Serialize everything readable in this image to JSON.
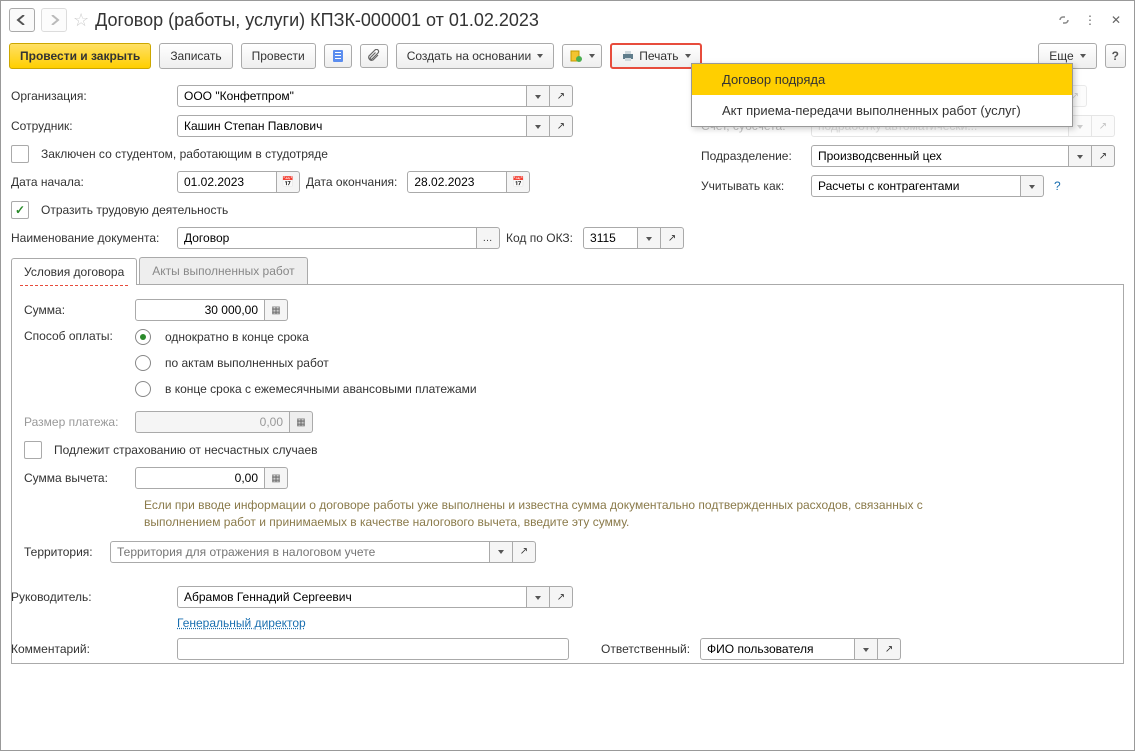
{
  "title": "Договор (работы, услуги) КПЗК-000001 от 01.02.2023",
  "toolbar": {
    "post_close": "Провести и закрыть",
    "save": "Записать",
    "post": "Провести",
    "create_based": "Создать на основании",
    "print": "Печать",
    "more": "Еще",
    "help": "?"
  },
  "print_menu": {
    "item1": "Договор подряда",
    "item2": "Акт приема-передачи выполненных работ (услуг)"
  },
  "left": {
    "org_label": "Организация:",
    "org_value": "ООО \"Конфетпром\"",
    "emp_label": "Сотрудник:",
    "emp_value": "Кашин Степан Павлович",
    "student_cb": "Заключен со студентом, работающим в студотряде",
    "date_start_label": "Дата начала:",
    "date_start": "01.02.2023",
    "date_end_label": "Дата окончания:",
    "date_end": "28.02.2023",
    "reflect_cb": "Отразить трудовую деятельность",
    "docname_label": "Наименование документа:",
    "docname": "Договор",
    "okz_label": "Код по ОКЗ:",
    "okz": "3115"
  },
  "right": {
    "pad_label": "подработку автоматически...",
    "division_label": "Подразделение:",
    "division": "Производсвенный цех",
    "account_label": "Учитывать как:",
    "account": "Расчеты с контрагентами"
  },
  "tabs": {
    "t1": "Условия договора",
    "t2": "Акты выполненных работ"
  },
  "contract": {
    "sum_label": "Сумма:",
    "sum": "30 000,00",
    "pay_label": "Способ оплаты:",
    "pay1": "однократно в конце срока",
    "pay2": "по актам выполненных работ",
    "pay3": "в конце срока с ежемесячными авансовыми платежами",
    "size_label": "Размер платежа:",
    "size": "0,00",
    "insure_cb": "Подлежит страхованию от несчастных случаев",
    "deduct_label": "Сумма вычета:",
    "deduct": "0,00",
    "hint": "Если при вводе информации о договоре работы уже выполнены и известна сумма документально подтвержденных расходов, связанных с выполнением работ и принимаемых в качестве налогового вычета, введите эту сумму.",
    "terr_label": "Территория:",
    "terr_placeholder": "Территория для отражения в налоговом учете"
  },
  "footer": {
    "manager_label": "Руководитель:",
    "manager": "Абрамов Геннадий Сергеевич",
    "position": "Генеральный директор",
    "comment_label": "Комментарий:",
    "resp_label": "Ответственный:",
    "resp": "ФИО пользователя"
  }
}
